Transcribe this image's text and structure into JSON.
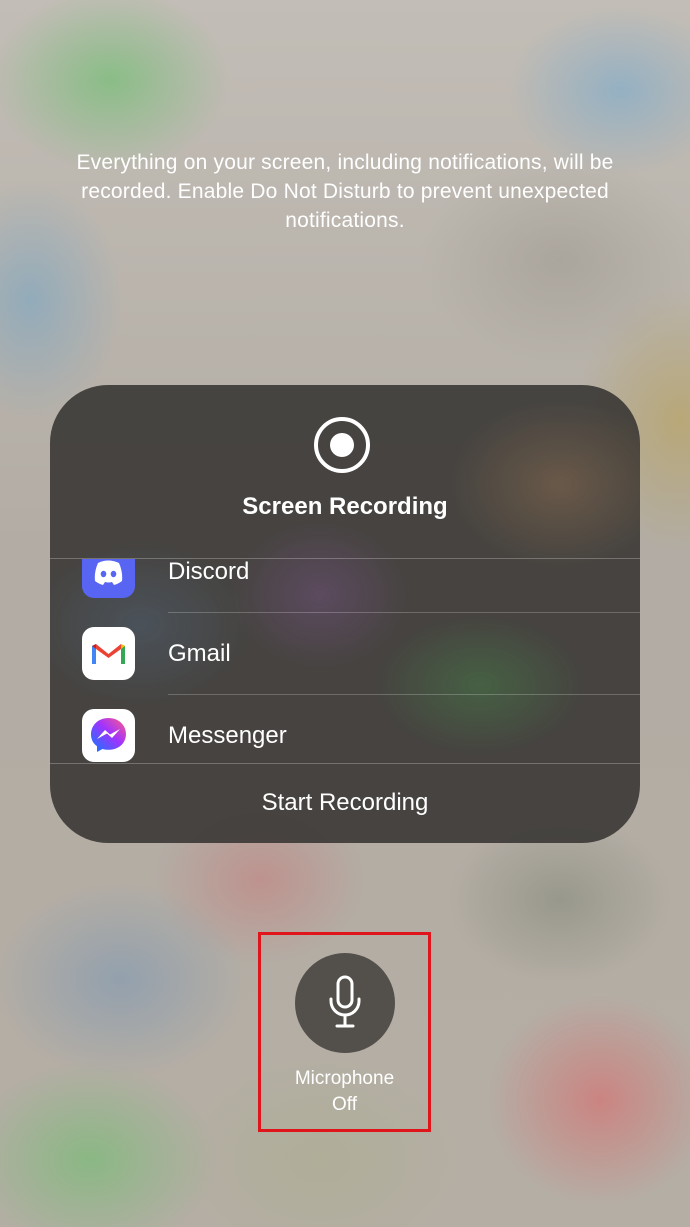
{
  "info_text": "Everything on your screen, including notifications, will be recorded. Enable Do Not Disturb to prevent unexpected notifications.",
  "panel": {
    "title": "Screen Recording",
    "apps": [
      {
        "label": "Discord",
        "icon": "discord-icon",
        "color": "#5865F2"
      },
      {
        "label": "Gmail",
        "icon": "gmail-icon",
        "color": "#EA4335"
      },
      {
        "label": "Messenger",
        "icon": "messenger-icon",
        "color": "#A033FF"
      }
    ],
    "start_label": "Start Recording"
  },
  "microphone": {
    "label": "Microphone",
    "state": "Off",
    "highlight_color": "#E0151B"
  }
}
